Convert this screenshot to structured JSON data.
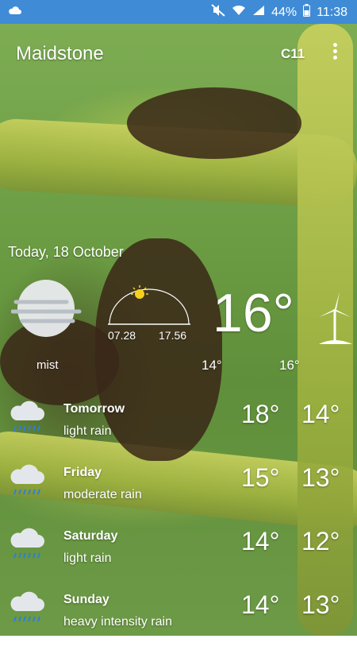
{
  "status_bar": {
    "battery": "44%",
    "time": "11:38",
    "icons": [
      "notification-cloud-icon",
      "mute-icon",
      "wifi-icon",
      "signal-icon",
      "battery-icon"
    ]
  },
  "app_bar": {
    "city": "Maidstone",
    "unit_label": "C11",
    "menu_icon": "overflow-menu-icon"
  },
  "today": {
    "date": "Today, 18 October",
    "condition": "mist",
    "sunrise": "07.28",
    "sunset": "17.56",
    "temp": "16°",
    "low": "14°",
    "high": "16°",
    "icons": [
      "mist-icon",
      "sun-arc-icon",
      "wind-turbine-icon"
    ]
  },
  "forecast": [
    {
      "day": "Tomorrow",
      "desc": "light rain",
      "hi": "18°",
      "lo": "14°",
      "icon": "rain-cloud-icon"
    },
    {
      "day": "Friday",
      "desc": "moderate rain",
      "hi": "15°",
      "lo": "13°",
      "icon": "rain-cloud-icon"
    },
    {
      "day": "Saturday",
      "desc": "light rain",
      "hi": "14°",
      "lo": "12°",
      "icon": "rain-cloud-icon"
    },
    {
      "day": "Sunday",
      "desc": "heavy intensity rain",
      "hi": "14°",
      "lo": "13°",
      "icon": "rain-cloud-icon"
    }
  ],
  "colors": {
    "status_bar": "#3f8bd6",
    "rain_drops": "#2f7fd6"
  }
}
